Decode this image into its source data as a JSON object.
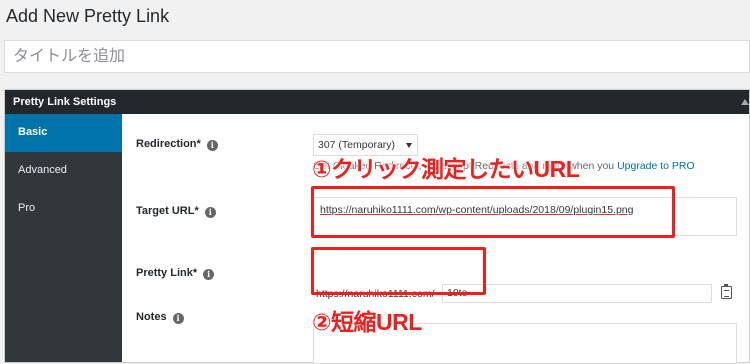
{
  "page": {
    "title": "Add New Pretty Link"
  },
  "title_field": {
    "placeholder": "タイトルを追加",
    "value": ""
  },
  "settings": {
    "header": "Pretty Link Settings",
    "tabs": [
      {
        "label": "Basic",
        "active": true
      },
      {
        "label": "Advanced",
        "active": false
      },
      {
        "label": "Pro",
        "active": false
      }
    ],
    "redirection": {
      "label": "Redirection*",
      "selected": "307 (Temporary)",
      "description_prefix": "Get Cloaked Redirects, Javascript Redirects and more when you",
      "description_link": "Upgrade to PRO"
    },
    "target_url": {
      "label": "Target URL*",
      "value": "https://naruhiko1111.com/wp-content/uploads/2018/09/plugin15.png"
    },
    "pretty_link": {
      "label": "Pretty Link*",
      "prefix": "https://naruhiko1111.com/",
      "slug": "10te"
    },
    "notes": {
      "label": "Notes",
      "value": ""
    }
  },
  "annotations": {
    "first": "①クリック測定したいURL",
    "second": "②短縮URL"
  },
  "colors": {
    "annotation": "#f11e1e",
    "tab_active": "#0073aa",
    "sidebar": "#32373c",
    "header": "#23282d"
  }
}
